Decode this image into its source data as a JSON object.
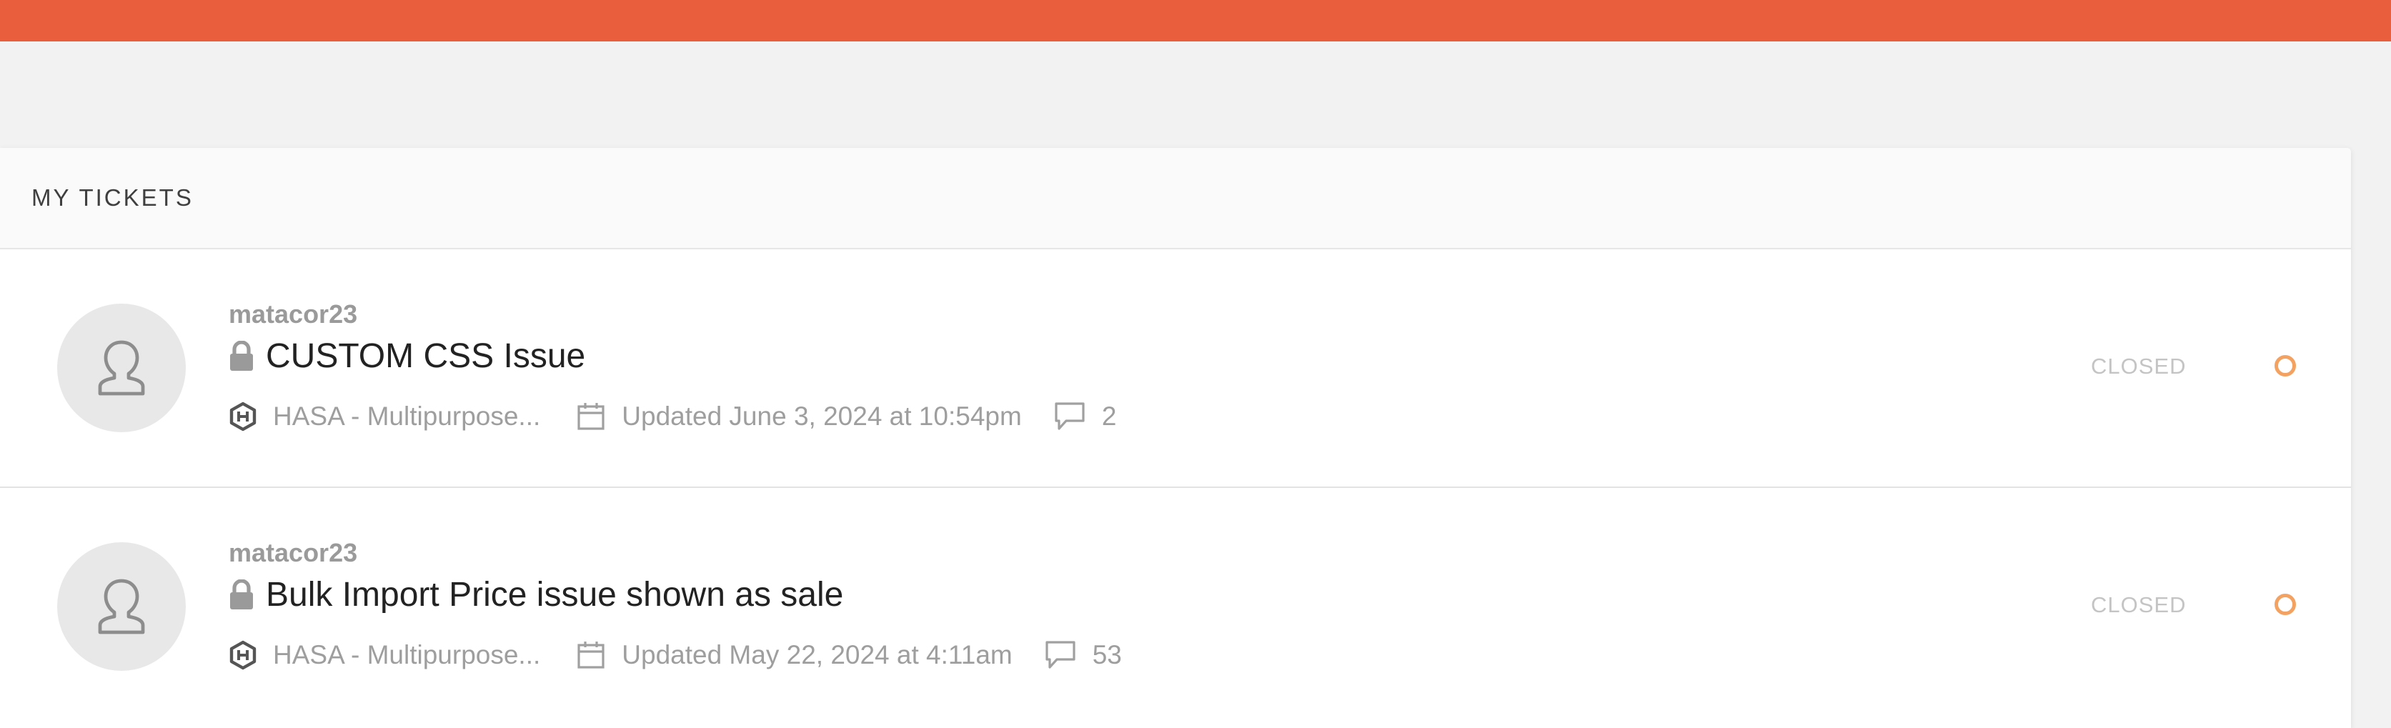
{
  "colors": {
    "topbar": "#e95e3c",
    "status_dot": "#f4a262"
  },
  "panel": {
    "title": "MY TICKETS"
  },
  "tickets": [
    {
      "author": "matacor23",
      "title": "CUSTOM CSS Issue",
      "product": "HASA - Multipurpose...",
      "updated": "Updated June 3, 2024 at 10:54pm",
      "comments": "2",
      "status": "CLOSED",
      "icons": [
        "user-avatar-icon",
        "lock-icon",
        "product-hex-icon",
        "calendar-icon",
        "comment-icon",
        "status-circle-icon"
      ]
    },
    {
      "author": "matacor23",
      "title": "Bulk Import Price issue shown as sale",
      "product": "HASA - Multipurpose...",
      "updated": "Updated May 22, 2024 at 4:11am",
      "comments": "53",
      "status": "CLOSED",
      "icons": [
        "user-avatar-icon",
        "lock-icon",
        "product-hex-icon",
        "calendar-icon",
        "comment-icon",
        "status-circle-icon"
      ]
    }
  ]
}
